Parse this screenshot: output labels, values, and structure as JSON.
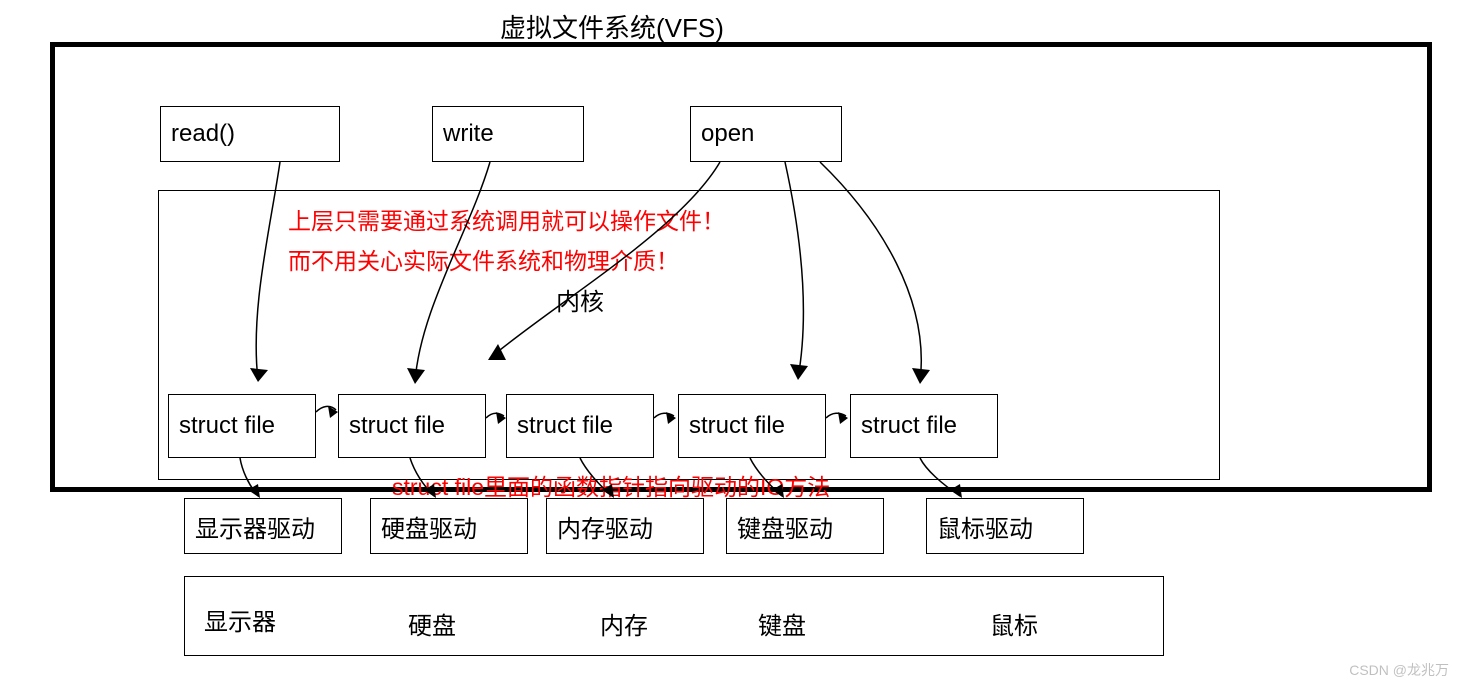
{
  "title": "虚拟文件系统(VFS)",
  "syscalls": {
    "read": "read()",
    "write": "write",
    "open": "open"
  },
  "notes": {
    "line1": "上层只需要通过系统调用就可以操作文件！",
    "line2": "而不用关心实际文件系统和物理介质！",
    "struct_note": "struct file里面的函数指针指向驱动的IO方法"
  },
  "kernel_label": "内核",
  "struct_files": [
    "struct file",
    "struct file",
    "struct file",
    "struct file",
    "struct file"
  ],
  "drivers": [
    "显示器驱动",
    "硬盘驱动",
    "内存驱动",
    "键盘驱动",
    "鼠标驱动"
  ],
  "devices": [
    "显示器",
    "硬盘",
    "内存",
    "键盘",
    "鼠标"
  ],
  "watermark": "CSDN @龙兆万"
}
